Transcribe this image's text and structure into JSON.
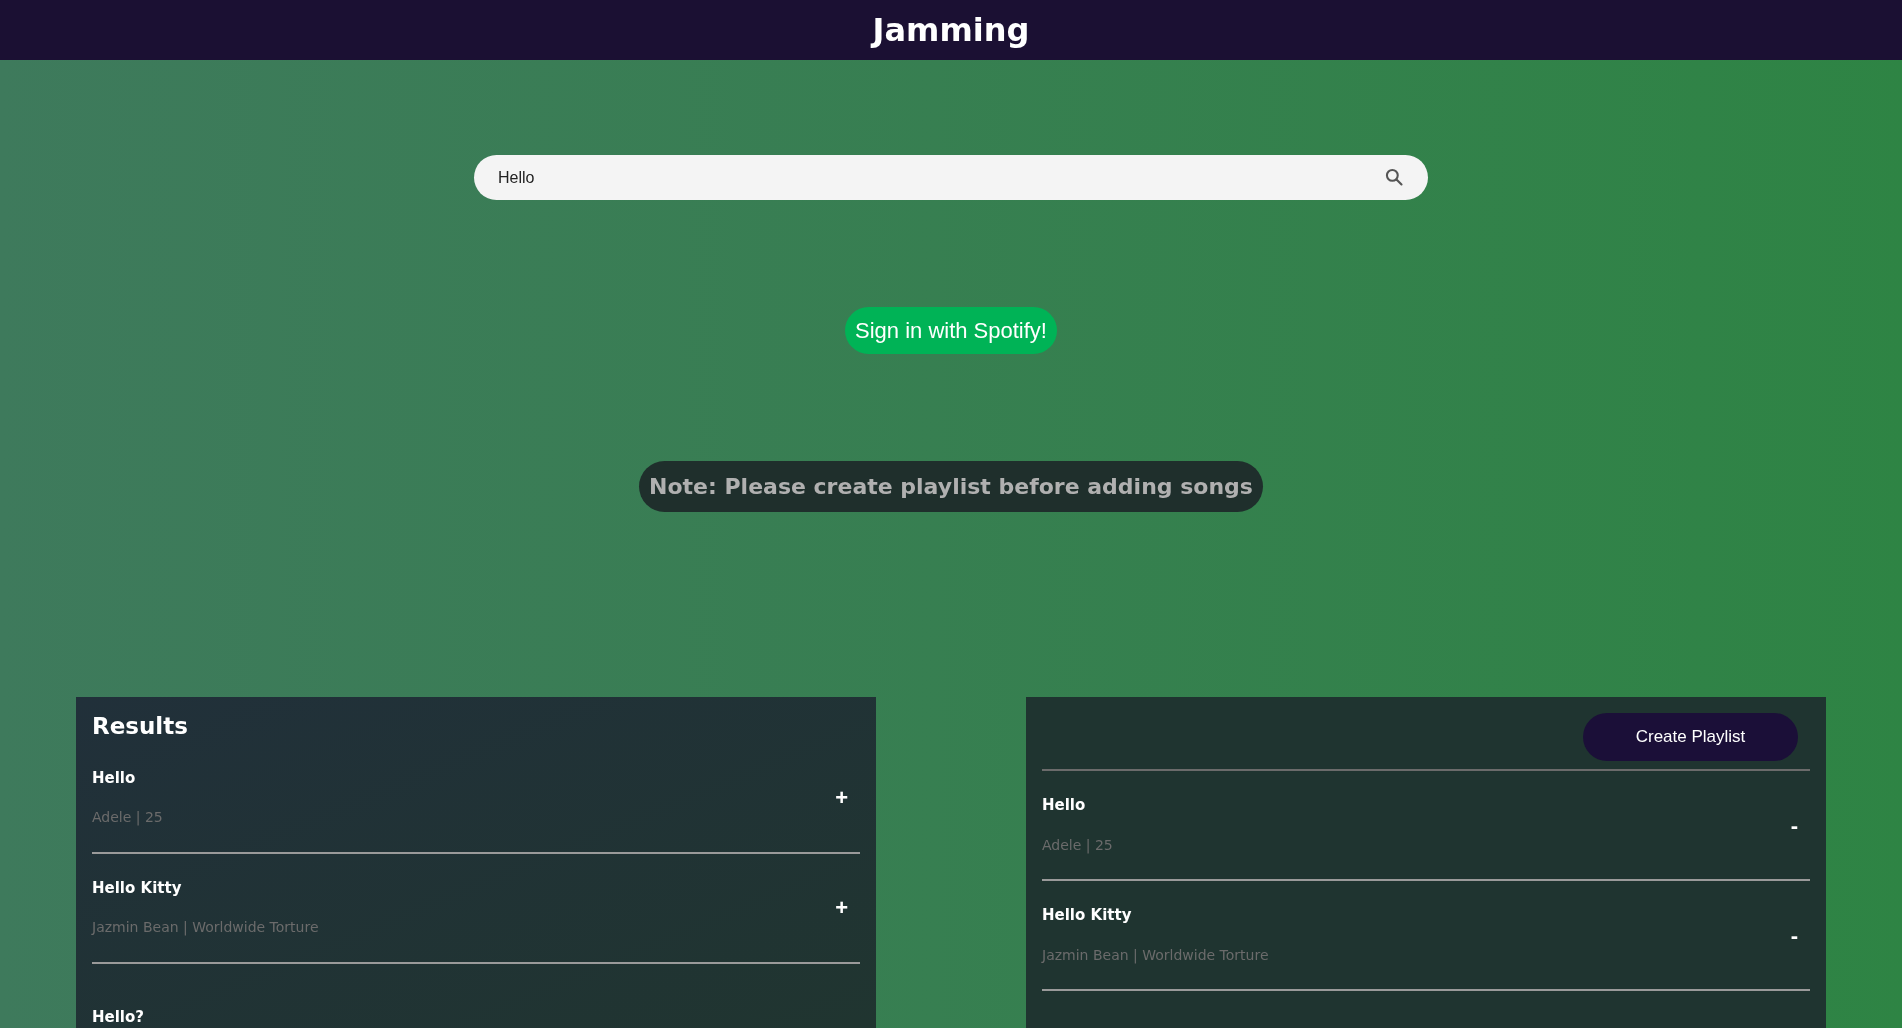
{
  "header": {
    "title": "Jamming"
  },
  "search": {
    "value": "Hello"
  },
  "sign_in_button": "Sign in with Spotify!",
  "note": "Note: Please create playlist before adding songs",
  "results": {
    "title": "Results",
    "tracks": [
      {
        "name": "Hello",
        "details": "Adele | 25",
        "action": "+"
      },
      {
        "name": "Hello Kitty",
        "details": "Jazmin Bean | Worldwide Torture",
        "action": "+"
      },
      {
        "name": "Hello?"
      }
    ]
  },
  "playlist": {
    "create_button": "Create Playlist",
    "tracks": [
      {
        "name": "Hello",
        "details": "Adele | 25",
        "action": "-"
      },
      {
        "name": "Hello Kitty",
        "details": "Jazmin Bean | Worldwide Torture",
        "action": "-"
      }
    ]
  }
}
